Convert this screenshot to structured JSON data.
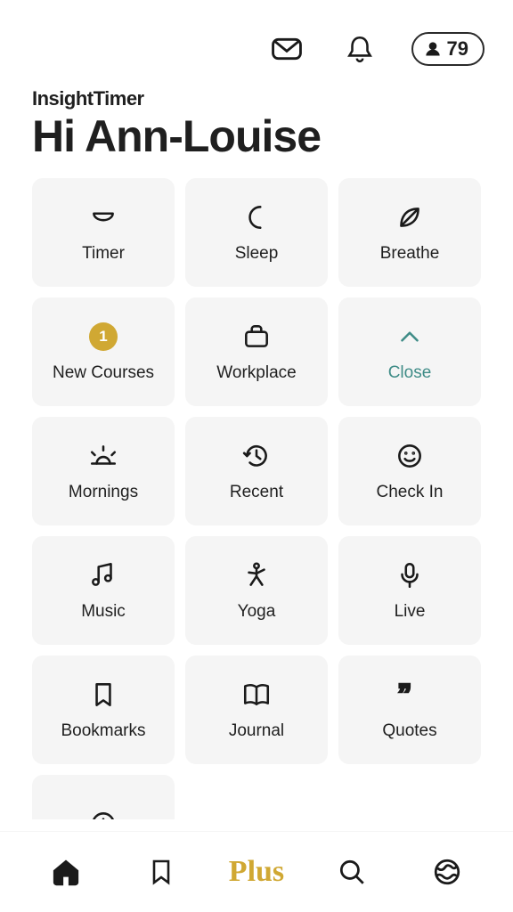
{
  "header": {
    "follower_count": "79"
  },
  "brand": {
    "prefix": "Insight",
    "suffix": "Timer"
  },
  "greeting": "Hi Ann-Louise",
  "tiles": [
    {
      "label": "Timer",
      "icon": "bowl",
      "badge": null,
      "style": "normal"
    },
    {
      "label": "Sleep",
      "icon": "moon",
      "badge": null,
      "style": "normal"
    },
    {
      "label": "Breathe",
      "icon": "leaf",
      "badge": null,
      "style": "normal"
    },
    {
      "label": "New Courses",
      "icon": "badge",
      "badge": "1",
      "style": "normal"
    },
    {
      "label": "Workplace",
      "icon": "briefcase",
      "badge": null,
      "style": "normal"
    },
    {
      "label": "Close",
      "icon": "chevron-up",
      "badge": null,
      "style": "teal"
    },
    {
      "label": "Mornings",
      "icon": "sunrise",
      "badge": null,
      "style": "normal"
    },
    {
      "label": "Recent",
      "icon": "history",
      "badge": null,
      "style": "normal"
    },
    {
      "label": "Check In",
      "icon": "smile",
      "badge": null,
      "style": "normal"
    },
    {
      "label": "Music",
      "icon": "music",
      "badge": null,
      "style": "normal"
    },
    {
      "label": "Yoga",
      "icon": "yoga",
      "badge": null,
      "style": "normal"
    },
    {
      "label": "Live",
      "icon": "mic",
      "badge": null,
      "style": "normal"
    },
    {
      "label": "Bookmarks",
      "icon": "bookmark",
      "badge": null,
      "style": "normal"
    },
    {
      "label": "Journal",
      "icon": "book",
      "badge": null,
      "style": "normal"
    },
    {
      "label": "Quotes",
      "icon": "quotes",
      "badge": null,
      "style": "normal"
    },
    {
      "label": "",
      "icon": "plus-circle",
      "badge": null,
      "style": "normal"
    }
  ],
  "tabbar": {
    "plus_label": "Plus"
  }
}
